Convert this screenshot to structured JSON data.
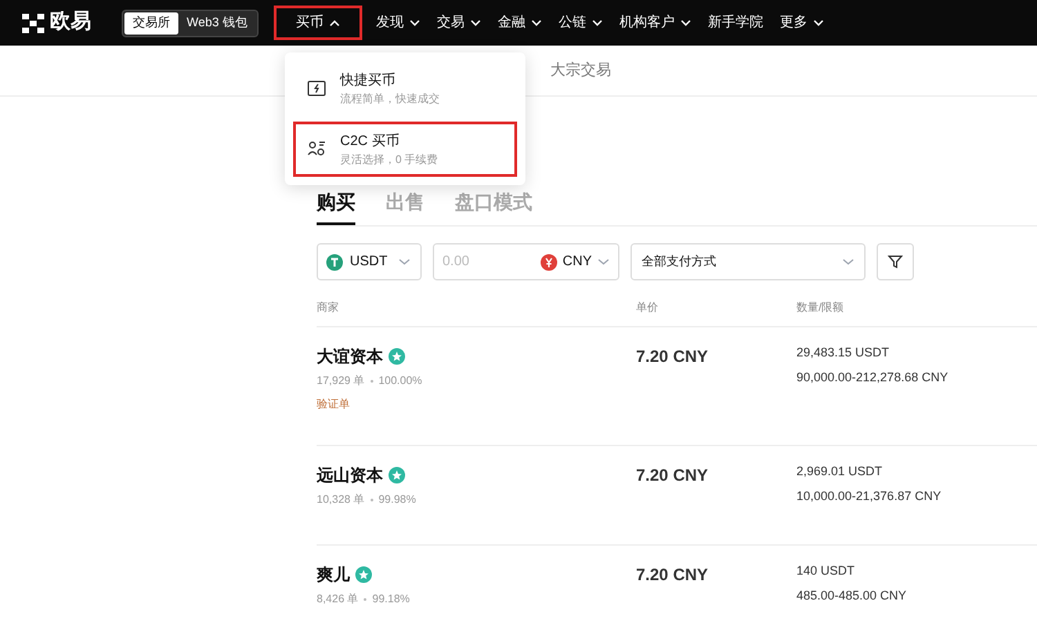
{
  "header": {
    "logo": "欧易",
    "mode_tabs": [
      {
        "label": "交易所",
        "selected": true
      },
      {
        "label": "Web3 钱包",
        "selected": false
      }
    ],
    "nav": [
      {
        "label": "买币",
        "expanded": true,
        "highlighted": true,
        "has_caret": true
      },
      {
        "label": "发现",
        "expanded": false,
        "highlighted": false,
        "has_caret": true
      },
      {
        "label": "交易",
        "expanded": false,
        "highlighted": false,
        "has_caret": true
      },
      {
        "label": "金融",
        "expanded": false,
        "highlighted": false,
        "has_caret": true
      },
      {
        "label": "公链",
        "expanded": false,
        "highlighted": false,
        "has_caret": true
      },
      {
        "label": "机构客户",
        "expanded": false,
        "highlighted": false,
        "has_caret": true
      },
      {
        "label": "新手学院",
        "highlighted": false,
        "has_caret": false
      },
      {
        "label": "更多",
        "expanded": false,
        "highlighted": false,
        "has_caret": true
      }
    ]
  },
  "dropdown": {
    "items": [
      {
        "kind": "quick",
        "title": "快捷买币",
        "subtitle": "流程简单，快速成交",
        "highlighted": false
      },
      {
        "kind": "c2c",
        "title": "C2C 买币",
        "subtitle": "灵活选择，0 手续费",
        "highlighted": true
      }
    ]
  },
  "subnav": {
    "label": "大宗交易"
  },
  "tabs": [
    {
      "label": "购买",
      "selected": true
    },
    {
      "label": "出售",
      "selected": false
    },
    {
      "label": "盘口模式",
      "selected": false
    }
  ],
  "filters": {
    "coin": "USDT",
    "amount": {
      "placeholder": "0.00"
    },
    "currency": "CNY",
    "payment": "全部支付方式"
  },
  "table": {
    "columns": [
      "商家",
      "单价",
      "数量/限额"
    ],
    "rows": [
      {
        "merchant": "大谊资本",
        "orders": "17,929 单",
        "completion": "100.00%",
        "tag": "验证单",
        "price": "7.20 CNY",
        "quantity": "29,483.15 USDT",
        "limit": "90,000.00-212,278.68 CNY"
      },
      {
        "merchant": "远山资本",
        "orders": "10,328 单",
        "completion": "99.98%",
        "price": "7.20 CNY",
        "quantity": "2,969.01 USDT",
        "limit": "10,000.00-21,376.87 CNY"
      },
      {
        "merchant": "爽儿",
        "orders": "8,426 单",
        "completion": "99.18%",
        "price": "7.20 CNY",
        "quantity": "140 USDT",
        "limit": "485.00-485.00 CNY"
      }
    ]
  }
}
